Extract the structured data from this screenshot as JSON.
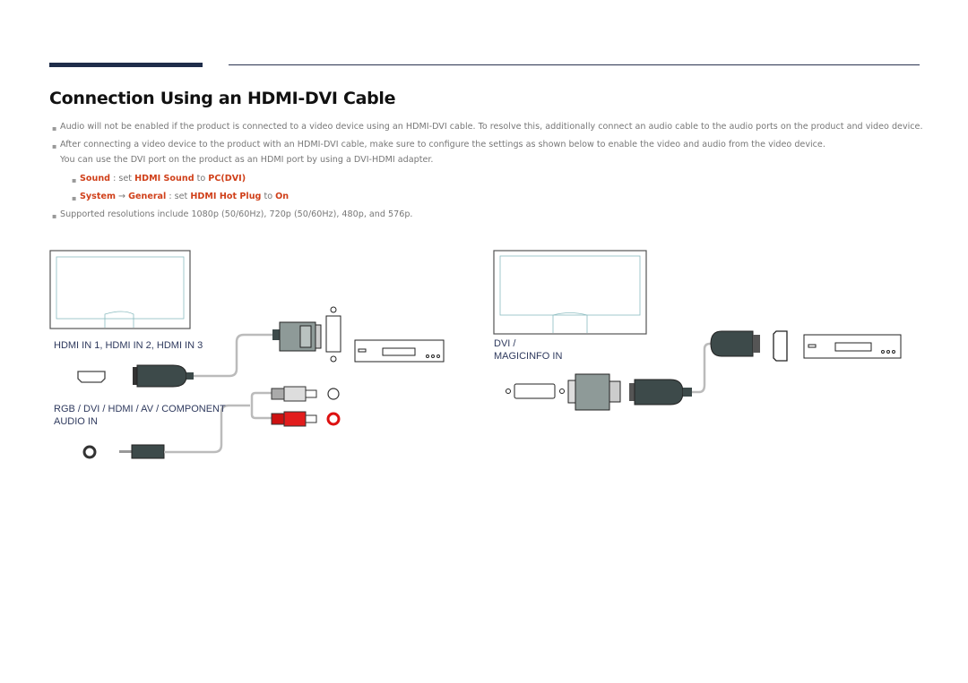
{
  "header": {
    "title": "Connection Using an HDMI-DVI Cable"
  },
  "notes": [
    "Audio will not be enabled if the product is connected to a video device using an HDMI-DVI cable. To resolve this, additionally connect an audio cable to the audio ports on the product and video device.",
    "After connecting a video device to the product with an HDMI-DVI cable, make sure to configure the settings as shown below to enable the video and audio from the video device.",
    "You can use the DVI port on the product as an HDMI port by using a DVI-HDMI adapter."
  ],
  "settings": [
    {
      "menu": "Sound",
      "sep": " : set ",
      "item": "HDMI Sound",
      "to": " to ",
      "value": "PC(DVI)"
    },
    {
      "menu": "System",
      "arrow": " → ",
      "menu2": "General",
      "sep": " : set ",
      "item": "HDMI Hot Plug",
      "to": " to ",
      "value": "On"
    }
  ],
  "resolutions": "Supported resolutions include 1080p (50/60Hz), 720p (50/60Hz), 480p, and 576p.",
  "diagram1": {
    "hdmi_label": "HDMI IN 1, HDMI IN 2, HDMI IN 3",
    "audio_label_1": "RGB / DVI / HDMI / AV / COMPONENT",
    "audio_label_2": "AUDIO IN"
  },
  "diagram2": {
    "label_1": "DVI /",
    "label_2": "MAGICINFO IN"
  },
  "colors": {
    "accent": "#d0401a",
    "navy": "#1f2d4a",
    "label": "#2f3a5e"
  }
}
